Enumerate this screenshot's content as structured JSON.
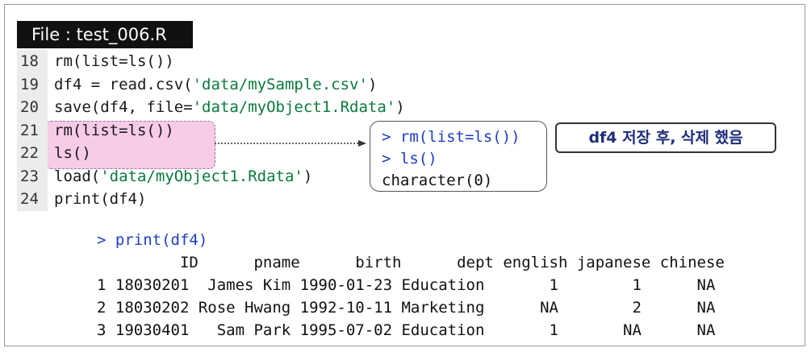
{
  "file_label": "File : test_006.R",
  "code_lines": [
    {
      "num": "18",
      "parts": [
        [
          "op",
          "rm(list=ls())"
        ]
      ]
    },
    {
      "num": "19",
      "parts": [
        [
          "op",
          "df4 = read.csv("
        ],
        [
          "str",
          "'data/mySample.csv'"
        ],
        [
          "op",
          ")"
        ]
      ]
    },
    {
      "num": "20",
      "parts": [
        [
          "op",
          "save(df4, file="
        ],
        [
          "str",
          "'data/myObject1.Rdata'"
        ],
        [
          "op",
          ")"
        ]
      ]
    },
    {
      "num": "21",
      "parts": [
        [
          "op",
          "rm(list=ls())"
        ]
      ]
    },
    {
      "num": "22",
      "parts": [
        [
          "op",
          "ls()"
        ]
      ]
    },
    {
      "num": "23",
      "parts": [
        [
          "op",
          "load("
        ],
        [
          "str",
          "'data/myObject1.Rdata'"
        ],
        [
          "op",
          ")"
        ]
      ]
    },
    {
      "num": "24",
      "parts": [
        [
          "op",
          "print(df4)"
        ]
      ]
    }
  ],
  "console_box": {
    "lines": [
      {
        "prompt": "> ",
        "text": "rm(list=ls())"
      },
      {
        "prompt": "> ",
        "text": "ls()"
      },
      {
        "prompt": "",
        "text": "character(0)"
      }
    ]
  },
  "note": "df4 저장 후, 삭제 했음",
  "output": {
    "command": "> print(df4)",
    "header": "         ID      pname      birth      dept english japanese chinese",
    "rows": [
      "1 18030201  James Kim 1990-01-23 Education       1        1      NA",
      "2 18030202 Rose Hwang 1992-10-11 Marketing      NA        2      NA",
      "3 19030401   Sam Park 1995-07-02 Education       1       NA      NA"
    ]
  }
}
